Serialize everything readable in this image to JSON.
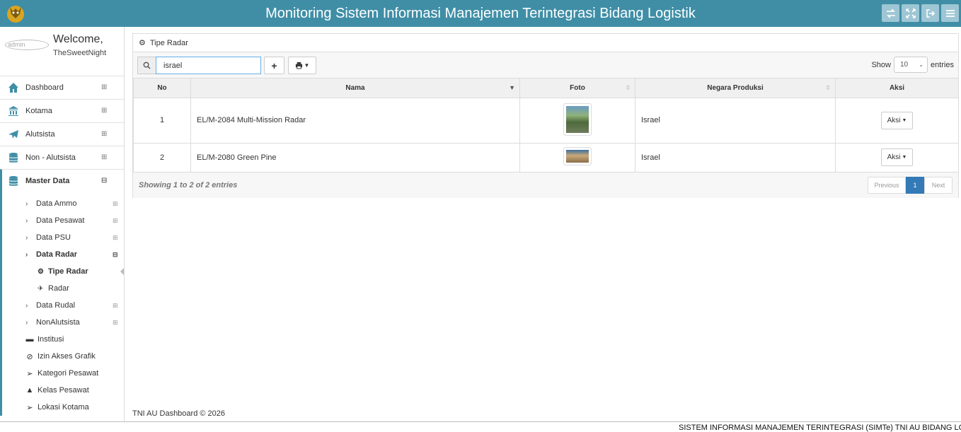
{
  "header": {
    "title": "Monitoring Sistem Informasi Manajemen Terintegrasi Bidang Logistik",
    "icons": [
      "exchange-icon",
      "fullscreen-icon",
      "logout-icon",
      "menu-icon"
    ],
    "color": "#3f8ea6"
  },
  "sidebar": {
    "avatar_text": "admin",
    "welcome": "Welcome,",
    "username": "TheSweetNight",
    "items": [
      {
        "label": "Dashboard",
        "icon": "home-icon"
      },
      {
        "label": "Kotama",
        "icon": "bank-icon"
      },
      {
        "label": "Alutsista",
        "icon": "plane-icon"
      },
      {
        "label": "Non - Alutsista",
        "icon": "database-icon"
      },
      {
        "label": "Master Data",
        "icon": "database-icon"
      }
    ],
    "master_sub": [
      {
        "label": "Data Ammo"
      },
      {
        "label": "Data Pesawat"
      },
      {
        "label": "Data PSU"
      },
      {
        "label": "Data Radar"
      }
    ],
    "radar_sub": [
      {
        "label": "Tipe Radar",
        "icon": "gear-icon"
      },
      {
        "label": "Radar",
        "icon": "plane-icon"
      }
    ],
    "master_sub2": [
      {
        "label": "Data Rudal"
      },
      {
        "label": "NonAlutsista"
      }
    ],
    "flat_items": [
      {
        "label": "Institusi",
        "icon": "briefcase-icon"
      },
      {
        "label": "Izin Akses Grafik",
        "icon": "ban-icon"
      },
      {
        "label": "Kategori Pesawat",
        "icon": "send-icon"
      },
      {
        "label": "Kelas Pesawat",
        "icon": "graduation-cap-icon"
      },
      {
        "label": "Lokasi Kotama",
        "icon": "send-icon"
      }
    ]
  },
  "panel": {
    "title": "Tipe Radar",
    "search_value": "israel",
    "show_label": "Show",
    "entries_value": "10",
    "entries_label": "entries",
    "columns": [
      "No",
      "Nama",
      "Foto",
      "Negara Produksi",
      "Aksi"
    ],
    "rows": [
      {
        "no": "1",
        "nama": "EL/M-2084 Multi-Mission Radar",
        "negara": "Israel",
        "aksi": "Aksi"
      },
      {
        "no": "2",
        "nama": "EL/M-2080 Green Pine",
        "negara": "Israel",
        "aksi": "Aksi"
      }
    ],
    "showing": "Showing 1 to 2 of 2 entries",
    "pager": {
      "prev": "Previous",
      "current": "1",
      "next": "Next"
    }
  },
  "footer": {
    "copyright": "TNI AU Dashboard © 2026",
    "status": "SISTEM INFORMASI MANAJEMEN TERINTEGRASI (SIMTe) TNI AU BIDANG LOGISTIK"
  }
}
